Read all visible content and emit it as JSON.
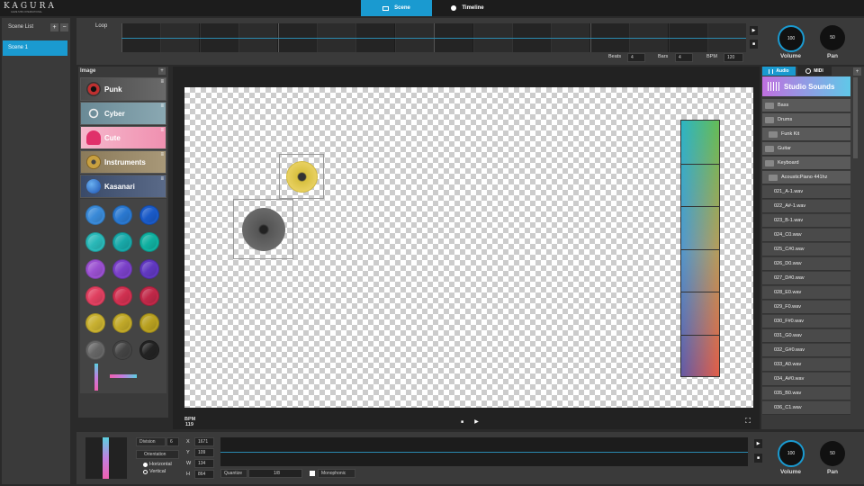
{
  "app": {
    "logo": "KAGURA",
    "logo_sub": "GAME SHIM INTERNATIONAL"
  },
  "tabs": [
    {
      "label": "Scene",
      "active": true
    },
    {
      "label": "Timeline",
      "active": false
    }
  ],
  "scene_list": {
    "title": "Scene List",
    "add": "+",
    "remove": "−",
    "items": [
      "Scene  1"
    ]
  },
  "loop": {
    "label": "Loop",
    "beats_label": "Beats",
    "beats": "4",
    "bars_label": "Bars",
    "bars": "4",
    "bpm_label": "BPM",
    "bpm": "120"
  },
  "top_knobs": {
    "volume_label": "Volume",
    "volume_value": "100",
    "pan_label": "Pan",
    "pan_value": "50"
  },
  "image_panel": {
    "title": "Image",
    "add": "+",
    "categories": [
      {
        "label": "Punk",
        "color": "#5c5c5c"
      },
      {
        "label": "Cyber",
        "color": "#7b9aa5"
      },
      {
        "label": "Cute",
        "color": "#f0a8c0"
      },
      {
        "label": "Instruments",
        "color": "#9a8a6a"
      },
      {
        "label": "Kasanari",
        "color": "#4a5a78"
      }
    ],
    "menu_glyph": "≡",
    "palette": [
      "#3a8ad8",
      "#2a78d0",
      "#1a5ac8",
      "#2ab8b8",
      "#18a8a8",
      "#10b0a0",
      "#9a50d0",
      "#7a40c8",
      "#6038c0",
      "#e04060",
      "#d03050",
      "#c02848",
      "#c8b030",
      "#c0a828",
      "#b8a020",
      "#666666",
      "#444444",
      "#222222"
    ]
  },
  "canvas": {
    "bpm_label": "BPM",
    "bpm_value": "119"
  },
  "transport": {
    "stop": "■",
    "play": "▶",
    "fullscreen": "⛶"
  },
  "right_panel": {
    "tab_audio": "Audio",
    "tab_midi": "MIDI",
    "add": "+",
    "header": "Studio Sounds",
    "folders": [
      "Bass",
      "Drums",
      "Funk Kit",
      "Guitar",
      "Keyboard",
      "AcousticPiano 441hz"
    ],
    "files": [
      "021_A-1.wav",
      "022_A#-1.wav",
      "023_B-1.wav",
      "024_C0.wav",
      "025_C#0.wav",
      "026_D0.wav",
      "027_D#0.wav",
      "028_E0.wav",
      "029_F0.wav",
      "030_F#0.wav",
      "031_G0.wav",
      "032_G#0.wav",
      "033_A0.wav",
      "034_A#0.wav",
      "035_B0.wav",
      "036_C1.wav"
    ]
  },
  "bottom": {
    "division_label": "Division",
    "division_value": "6",
    "orientation_label": "Orientation",
    "horizontal": "Horizontal",
    "vertical": "Vertical",
    "x_label": "X",
    "x_value": "1671",
    "y_label": "Y",
    "y_value": "109",
    "w_label": "W",
    "w_value": "134",
    "h_label": "H",
    "h_value": "864",
    "quantize_label": "Quantize",
    "quantize_value": "1/8",
    "mono_label": "Monophonic",
    "volume_label": "Volume",
    "volume_value": "100",
    "pan_label": "Pan",
    "pan_value": "50"
  }
}
